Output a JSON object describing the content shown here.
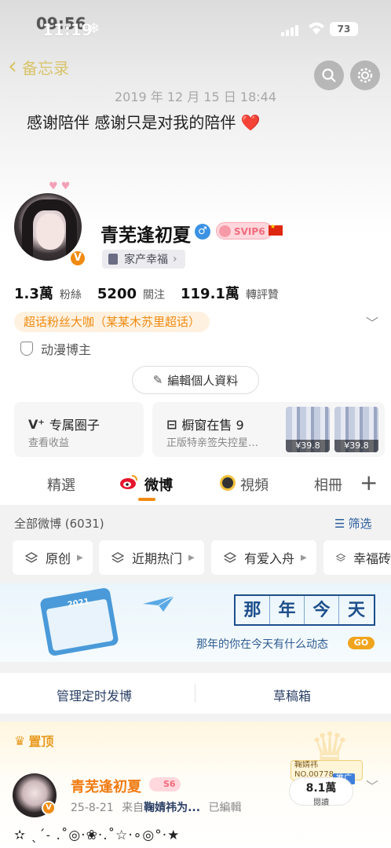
{
  "status_bar": {
    "time": "11:19",
    "time_ghost": "09:56",
    "battery": "73"
  },
  "nav": {
    "back_label": "备忘录"
  },
  "memory_post": {
    "date": "2019 年 12 月 15 日 18:44",
    "text": "感谢陪伴 感谢只是对我的陪伴",
    "emoji": "❤️"
  },
  "profile": {
    "name": "青芜逢初夏",
    "svip_level": "SVIP6",
    "verified_badge": "V",
    "family_tag": "家产幸福",
    "stats": [
      {
        "value": "1.3萬",
        "label": "粉絲"
      },
      {
        "value": "5200",
        "label": "關注"
      },
      {
        "value": "119.1萬",
        "label": "轉評贊"
      }
    ],
    "supertopic_tag": "超话粉丝大咖（某某木苏里超话）",
    "category_tag": "动漫博主",
    "edit_button": "編輯個人資料"
  },
  "cards": {
    "circle": {
      "title": "专属圈子",
      "subtitle": "查看收益"
    },
    "shop": {
      "title": "橱窗在售 9",
      "subtitle": "正版特亲签失控星…",
      "prices": [
        "¥39.8",
        "¥39.8"
      ]
    }
  },
  "tabs": [
    "精選",
    "微博",
    "視頻",
    "相冊"
  ],
  "feed": {
    "all_label": "全部微博 (6031)",
    "filter_label": "筛选",
    "chips": [
      "原创",
      "近期热门",
      "有爱入舟",
      "幸福砖"
    ]
  },
  "banner": {
    "calendar_year": "2021",
    "title_chars": [
      "那",
      "年",
      "今",
      "天"
    ],
    "subtitle": "那年的你在今天有什么动态",
    "go": "GO"
  },
  "actions": {
    "schedule": "管理定时发博",
    "drafts": "草稿箱"
  },
  "pinned_post": {
    "label": "置顶",
    "author": "青芜逢初夏",
    "level": "S6",
    "date": "25-8-21",
    "source_prefix": "来自",
    "source_name": "鞠婧祎为...",
    "edited": "已編輯",
    "reads_value": "8.1萬",
    "reads_label": "閱讀",
    "ad_name": "鞠婧祎",
    "ad_no": "NO.00778",
    "ad_tag": "推广",
    "body": "✫ ˎˊ˗ .˚◎·❀·.˚☆·∘◎°·★"
  },
  "colors": {
    "accent": "#f08b12",
    "link": "#2b3f66",
    "svip": "#f26b7d"
  }
}
